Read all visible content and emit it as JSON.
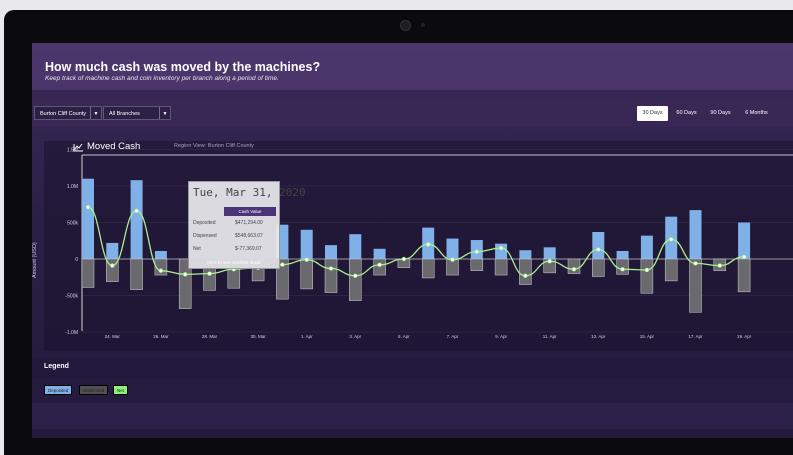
{
  "header": {
    "title": "How much cash was moved by the machines?",
    "subtitle": "Keep track of machine cash and coin inventory per branch along a period of time."
  },
  "filters": {
    "county": "Burton Cliff County",
    "branch": "All Branches"
  },
  "ranges": [
    "30 Days",
    "60 Days",
    "90 Days",
    "6 Months"
  ],
  "active_range": "30 Days",
  "chart": {
    "title": "Moved Cash",
    "region": "Region View: Burton Cliff County",
    "ylabel": "Amount (USD)"
  },
  "tooltip": {
    "date": "Tue, Mar 31, 2020",
    "column": "Cash Value",
    "rows": [
      {
        "label": "Deposited",
        "value": "$471,294.00"
      },
      {
        "label": "Dispensed",
        "value": "$548,663.07"
      },
      {
        "label": "Net",
        "value": "$-77,369.07"
      }
    ],
    "footer": "Click to see machine detail"
  },
  "legend": {
    "title": "Legend",
    "items": [
      {
        "label": "Deposited",
        "color": "#7fb0e8"
      },
      {
        "label": "Dispensed",
        "color": "#505050"
      },
      {
        "label": "Net",
        "color": "#8cf07a"
      }
    ]
  },
  "colors": {
    "deposited": "#7fb0e8",
    "dispensed": "#6a6a6e",
    "net": "#a8ef8c",
    "accent": "#4b3478"
  },
  "chart_data": {
    "type": "bar",
    "title": "Moved Cash",
    "ylabel": "Amount (USD)",
    "yticks": [
      "1.5M",
      "1.0M",
      "500k",
      "0",
      "-500k",
      "-1.0M"
    ],
    "ylim": [
      -1000000,
      1500000
    ],
    "xticks": [
      "24. Mar",
      "26. Mar",
      "28. Mar",
      "30. Mar",
      "1. Apr",
      "3. Apr",
      "5. Apr",
      "7. Apr",
      "9. Apr",
      "11. Apr",
      "13. Apr",
      "15. Apr",
      "17. Apr",
      "19. Apr"
    ],
    "series": [
      {
        "name": "Deposited",
        "values": [
          1100000,
          220000,
          1080000,
          110000,
          0,
          0,
          0,
          0,
          470000,
          400000,
          190000,
          340000,
          140000,
          0,
          430000,
          280000,
          260000,
          210000,
          120000,
          160000,
          0,
          370000,
          110000,
          320000,
          580000,
          670000,
          0,
          500000
        ]
      },
      {
        "name": "Dispensed",
        "values": [
          -390000,
          -310000,
          -420000,
          -220000,
          -680000,
          -430000,
          -400000,
          -300000,
          -550000,
          -410000,
          -460000,
          -570000,
          -220000,
          -120000,
          -260000,
          -220000,
          -160000,
          -220000,
          -350000,
          -190000,
          -200000,
          -240000,
          -210000,
          -470000,
          -300000,
          -730000,
          -160000,
          -450000
        ]
      },
      {
        "name": "Net",
        "values": [
          710000,
          -90000,
          660000,
          -160000,
          -210000,
          -200000,
          -140000,
          -120000,
          -77369,
          -10000,
          -130000,
          -230000,
          -80000,
          0,
          200000,
          -10000,
          100000,
          150000,
          -230000,
          -30000,
          -140000,
          130000,
          -140000,
          -150000,
          270000,
          -60000,
          -90000,
          30000
        ]
      }
    ]
  }
}
